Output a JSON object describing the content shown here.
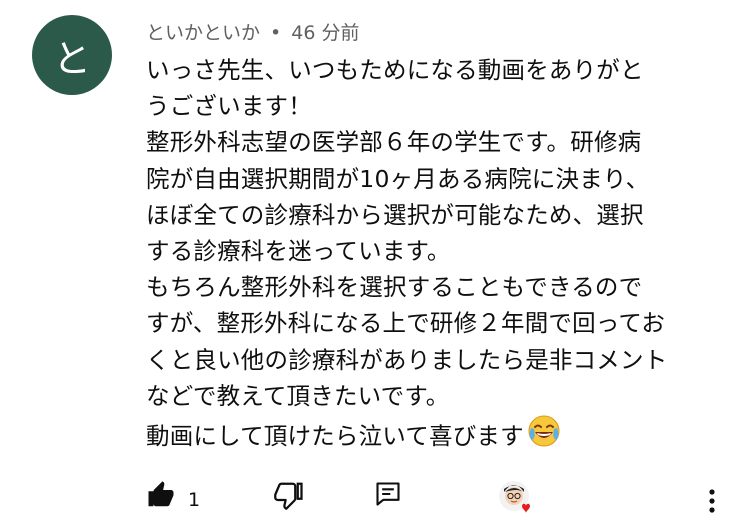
{
  "comment": {
    "avatar_letter": "と",
    "avatar_color": "#2c5a4a",
    "author": "といかといか",
    "separator": "•",
    "time": "46 分前",
    "lines": [
      "いっさ先生、いつもためになる動画をありがと",
      "うございます！",
      "整形外科志望の医学部６年の学生です。研修病",
      "院が自由選択期間が10ヶ月ある病院に決まり、",
      "ほぼ全ての診療科から選択が可能なため、選択",
      "する診療科を迷っています。",
      "もちろん整形外科を選択することもできるので",
      "すが、整形外科になる上で研修２年間で回ってお",
      "くと良い他の診療科がありましたら是非コメント",
      "などで教えて頂きたいです。",
      "動画にして頂けたら泣いて喜びます"
    ],
    "emoji": "joy-emoji"
  },
  "actions": {
    "like_count": "1",
    "like_icon": "thumbs-up-icon",
    "dislike_icon": "thumbs-down-icon",
    "reply_icon": "reply-icon",
    "creator_heart": "creator-heart-avatar",
    "more_icon": "more-vertical-icon"
  }
}
